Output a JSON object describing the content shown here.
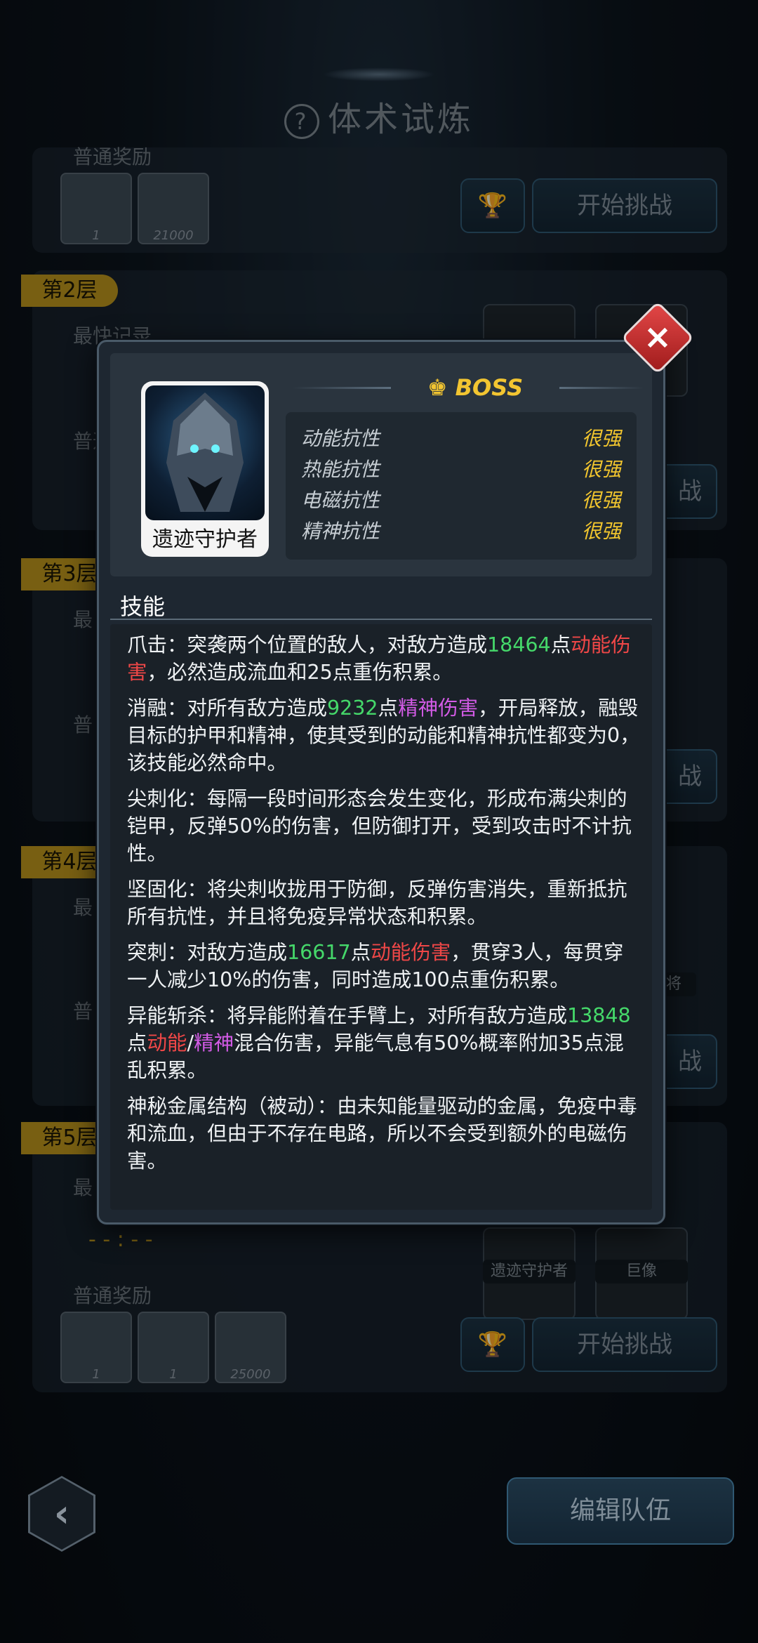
{
  "header": {
    "help_icon": "?",
    "title": "体术试炼"
  },
  "stages": {
    "top_reward_label": "普通奖励",
    "top_rewards": [
      "1",
      "21000"
    ],
    "floors": [
      {
        "tag": "第2层",
        "best_label": "最快记录",
        "reward_label": "普通",
        "fight_label": "战"
      },
      {
        "tag": "第3层",
        "best_label": "最",
        "reward_label": "普",
        "fight_label": "战"
      },
      {
        "tag": "第4层",
        "best_label": "最",
        "reward_label": "普",
        "fight_label": "战",
        "enemy_label": "将"
      },
      {
        "tag": "第5层",
        "best_label": "最",
        "best_value": "- - : - -",
        "reward_label": "普通奖励",
        "rewards": [
          "1",
          "1",
          "25000"
        ],
        "enemies": [
          "遗迹守护者",
          "巨像"
        ]
      }
    ],
    "start_button": "开始挑战"
  },
  "modal": {
    "close_icon": "×",
    "boss_label": "BOSS",
    "boss_name": "遗迹守护者",
    "resistances": [
      {
        "name": "动能抗性",
        "value": "很强"
      },
      {
        "name": "热能抗性",
        "value": "很强"
      },
      {
        "name": "电磁抗性",
        "value": "很强"
      },
      {
        "name": "精神抗性",
        "value": "很强"
      }
    ],
    "skills_title": "技能",
    "skills": [
      {
        "name": "爪击",
        "t1": "：突袭两个位置的敌人，对敌方造成",
        "n1": "18464",
        "t2": "点",
        "d1": "动能伤害",
        "t3": "，必然造成流血和25点重伤积累。"
      },
      {
        "name": "消融",
        "t1": "：对所有敌方造成",
        "n1": "9232",
        "t2": "点",
        "d1": "精神伤害",
        "t3": "，开局释放，融毁目标的护甲和精神，使其受到的动能和精神抗性都变为0，该技能必然命中。"
      },
      {
        "name": "尖刺化",
        "text": "：每隔一段时间形态会发生变化，形成布满尖刺的铠甲，反弹50%的伤害，但防御打开，受到攻击时不计抗性。"
      },
      {
        "name": "坚固化",
        "text": "：将尖刺收拢用于防御，反弹伤害消失，重新抵抗所有抗性，并且将免疫异常状态和积累。"
      },
      {
        "name": "突刺",
        "t1": "：对敌方造成",
        "n1": "16617",
        "t2": "点",
        "d1": "动能伤害",
        "t3": "，贯穿3人，每贯穿一人减少10%的伤害，同时造成100点重伤积累。"
      },
      {
        "name": "异能斩杀",
        "t1": "：将异能附着在手臂上，对所有敌方造成",
        "n1": "13848",
        "t2": "点",
        "d1": "动能",
        "sep": "/",
        "d2": "精神",
        "t3": "混合伤害，异能气息有50%概率附加35点混乱积累。"
      },
      {
        "name": "神秘金属结构（被动）",
        "text": "：由未知能量驱动的金属，免疫中毒和流血，但由于不存在电路，所以不会受到额外的电磁伤害。"
      }
    ]
  },
  "footer": {
    "back_icon": "‹",
    "edit_team": "编辑队伍"
  }
}
